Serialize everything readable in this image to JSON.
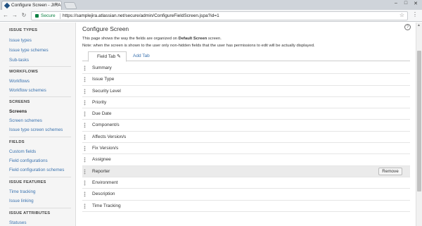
{
  "browser": {
    "tab_title": "Configure Screen - JIRA",
    "tab_close": "×",
    "window_controls": [
      "–",
      "□",
      "✕"
    ],
    "nav": {
      "back": "←",
      "forward": "→",
      "reload": "↻"
    },
    "secure_label": "Secure",
    "url": "https://samplejira.atlassian.net/secure/admin/ConfigureFieldScreen.jspa?id=1",
    "star": "☆",
    "menu": "⋮"
  },
  "sidebar": {
    "sections": [
      {
        "heading": "ISSUE TYPES",
        "items": [
          "Issue types",
          "Issue type schemes",
          "Sub-tasks"
        ]
      },
      {
        "heading": "WORKFLOWS",
        "items": [
          "Workflows",
          "Workflow schemes"
        ]
      },
      {
        "heading": "SCREENS",
        "items": [
          "Screens",
          "Screen schemes",
          "Issue type screen schemes"
        ],
        "active": "Screens"
      },
      {
        "heading": "FIELDS",
        "items": [
          "Custom fields",
          "Field configurations",
          "Field configuration schemes"
        ]
      },
      {
        "heading": "ISSUE FEATURES",
        "items": [
          "Time tracking",
          "Issue linking"
        ]
      },
      {
        "heading": "ISSUE ATTRIBUTES",
        "items": [
          "Statuses"
        ]
      }
    ]
  },
  "main": {
    "title": "Configure Screen",
    "help": "?",
    "description_prefix": "This page shows the way the fields are organized on ",
    "screen_name": "Default Screen",
    "description_suffix": " screen.",
    "note": "Note: when the screen is shown to the user only non-hidden fields that the user has permissions to edit will be actually displayed.",
    "tabs": {
      "active": "Field Tab",
      "add": "Add Tab",
      "edit_icon": "✎"
    },
    "fields": [
      "Summary",
      "Issue Type",
      "Security Level",
      "Priority",
      "Due Date",
      "Component/s",
      "Affects Version/s",
      "Fix Version/s",
      "Assignee",
      "Reporter",
      "Environment",
      "Description",
      "Time Tracking"
    ],
    "highlighted_field": "Reporter",
    "remove_label": "Remove"
  },
  "colors": {
    "link": "#3b73af",
    "secure": "#0b8043",
    "highlight_row": "#ebebeb"
  }
}
